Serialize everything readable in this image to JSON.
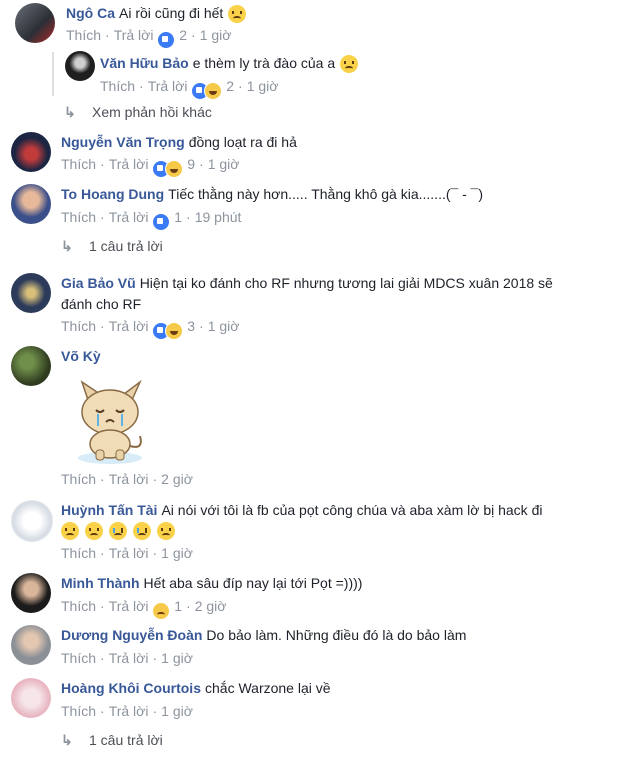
{
  "comments": [
    {
      "author": "Ngô Ca",
      "text": "Ai rồi cũng đi hết",
      "emoji": "sad",
      "actions": {
        "like": "Thích",
        "reply": "Trả lời",
        "count": "2",
        "time": "1 giờ",
        "reactions": [
          "like"
        ]
      }
    },
    {
      "author": "Văn Hữu Bảo",
      "text": "e thèm ly trà đào của a",
      "emoji": "sad",
      "actions": {
        "like": "Thích",
        "reply": "Trả lời",
        "count": "2",
        "time": "1 giờ",
        "reactions": [
          "like",
          "haha"
        ]
      }
    },
    {
      "author": "Nguyễn Văn Trọng",
      "text": "đồng loạt ra đi hả",
      "actions": {
        "like": "Thích",
        "reply": "Trả lời",
        "count": "9",
        "time": "1 giờ",
        "reactions": [
          "like",
          "haha"
        ]
      }
    },
    {
      "author": "To Hoang Dung",
      "text": "Tiếc thằng này hơn..... Thằng khô gà kia.......(¯ - ¯)",
      "actions": {
        "like": "Thích",
        "reply": "Trả lời",
        "count": "1",
        "time": "19 phút",
        "reactions": [
          "like"
        ]
      }
    },
    {
      "author": "Gia Bảo Vũ",
      "text": "Hiện tại ko đánh cho RF nhưng tương lai giải MDCS xuân 2018 sẽ",
      "text2": "đánh cho RF",
      "actions": {
        "like": "Thích",
        "reply": "Trả lời",
        "count": "3",
        "time": "1 giờ",
        "reactions": [
          "like",
          "haha"
        ]
      }
    },
    {
      "author": "Võ Kỳ",
      "text": "",
      "actions": {
        "like": "Thích",
        "reply": "Trả lời",
        "time": "2 giờ"
      }
    },
    {
      "author": "Huỳnh Tấn Tài",
      "text": "Ai nói với tôi là fb của pọt công chúa và aba xàm lờ bị hack đi",
      "actions": {
        "like": "Thích",
        "reply": "Trả lời",
        "time": "1 giờ"
      }
    },
    {
      "author": "Minh Thành",
      "text": "Hết aba sâu đíp nay lại tới Pọt =))))",
      "actions": {
        "like": "Thích",
        "reply": "Trả lời",
        "count": "1",
        "time": "2 giờ",
        "reactions": [
          "sad"
        ]
      }
    },
    {
      "author": "Dương Nguyễn Đoàn",
      "text": "Do bảo làm. Những điều đó là do bảo làm",
      "actions": {
        "like": "Thích",
        "reply": "Trả lời",
        "time": "1 giờ"
      }
    },
    {
      "author": "Hoàng Khôi Courtois",
      "text": "chắc Warzone lại về",
      "actions": {
        "like": "Thích",
        "reply": "Trả lời",
        "time": "1 giờ"
      }
    }
  ],
  "links": {
    "more_replies": "Xem phản hồi khác",
    "one_reply_a": "1 câu trả lời",
    "one_reply_b": "1 câu trả lời"
  },
  "icons": {
    "reply_arrow": "reply-arrow-icon",
    "like_reaction": "like-reaction-icon",
    "haha_reaction": "haha-reaction-icon",
    "sad_reaction": "sad-reaction-icon"
  },
  "colors": {
    "author": "#385898",
    "meta": "#8d949e",
    "like_reaction": "#3b7af5"
  }
}
